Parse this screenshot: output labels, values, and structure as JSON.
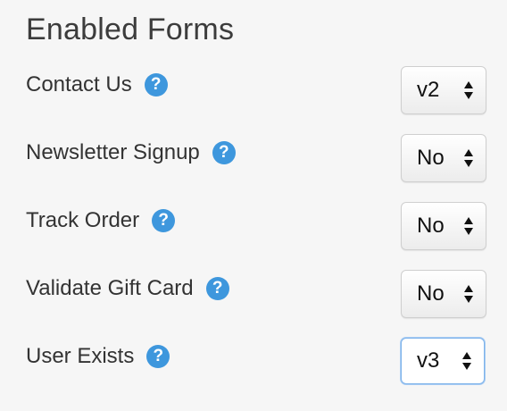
{
  "section": {
    "title": "Enabled Forms"
  },
  "forms": [
    {
      "label": "Contact Us",
      "value": "v2",
      "help_icon": "question-circle-icon"
    },
    {
      "label": "Newsletter Signup",
      "value": "No",
      "help_icon": "question-circle-icon"
    },
    {
      "label": "Track Order",
      "value": "No",
      "help_icon": "question-circle-icon"
    },
    {
      "label": "Validate Gift Card",
      "value": "No",
      "help_icon": "question-circle-icon"
    },
    {
      "label": "User Exists",
      "value": "v3",
      "help_icon": "question-circle-icon"
    }
  ],
  "help_glyph": "?",
  "colors": {
    "help_icon": "#3e97dd",
    "focus_border": "#7fb3ea",
    "background": "#f6f6f6"
  }
}
